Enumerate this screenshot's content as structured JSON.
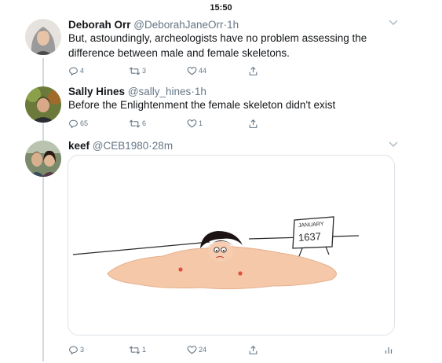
{
  "status_bar": {
    "time": "15:50"
  },
  "tweets": [
    {
      "name": "Deborah Orr",
      "handle": "@DeborahJaneOrr",
      "separator": "·",
      "time": "1h",
      "text": "But, astoundingly, archeologists have no problem assessing the difference between male and female skeletons.",
      "replies": "4",
      "retweets": "3",
      "likes": "44"
    },
    {
      "name": "Sally Hines",
      "handle": "@sally_hines",
      "separator": "·",
      "time": "1h",
      "text": "Before the Enlightenment the female skeleton didn't exist",
      "replies": "65",
      "retweets": "6",
      "likes": "1"
    },
    {
      "name": "keef",
      "handle": "@CEB1980",
      "separator": "·",
      "time": "28m",
      "replies": "3",
      "retweets": "1",
      "likes": "24",
      "image": {
        "sign_line1": "JANUARY",
        "sign_line2": "1637"
      }
    }
  ],
  "icons": {
    "reply": "reply-icon",
    "retweet": "retweet-icon",
    "like": "heart-icon",
    "share": "share-icon",
    "analytics": "analytics-icon",
    "more": "chevron-down-icon"
  },
  "colors": {
    "text_primary": "#14171a",
    "text_secondary": "#657786",
    "thread_line": "#cfd9de",
    "blob_skin": "#f4c8a8",
    "nipple": "#e0503c"
  }
}
